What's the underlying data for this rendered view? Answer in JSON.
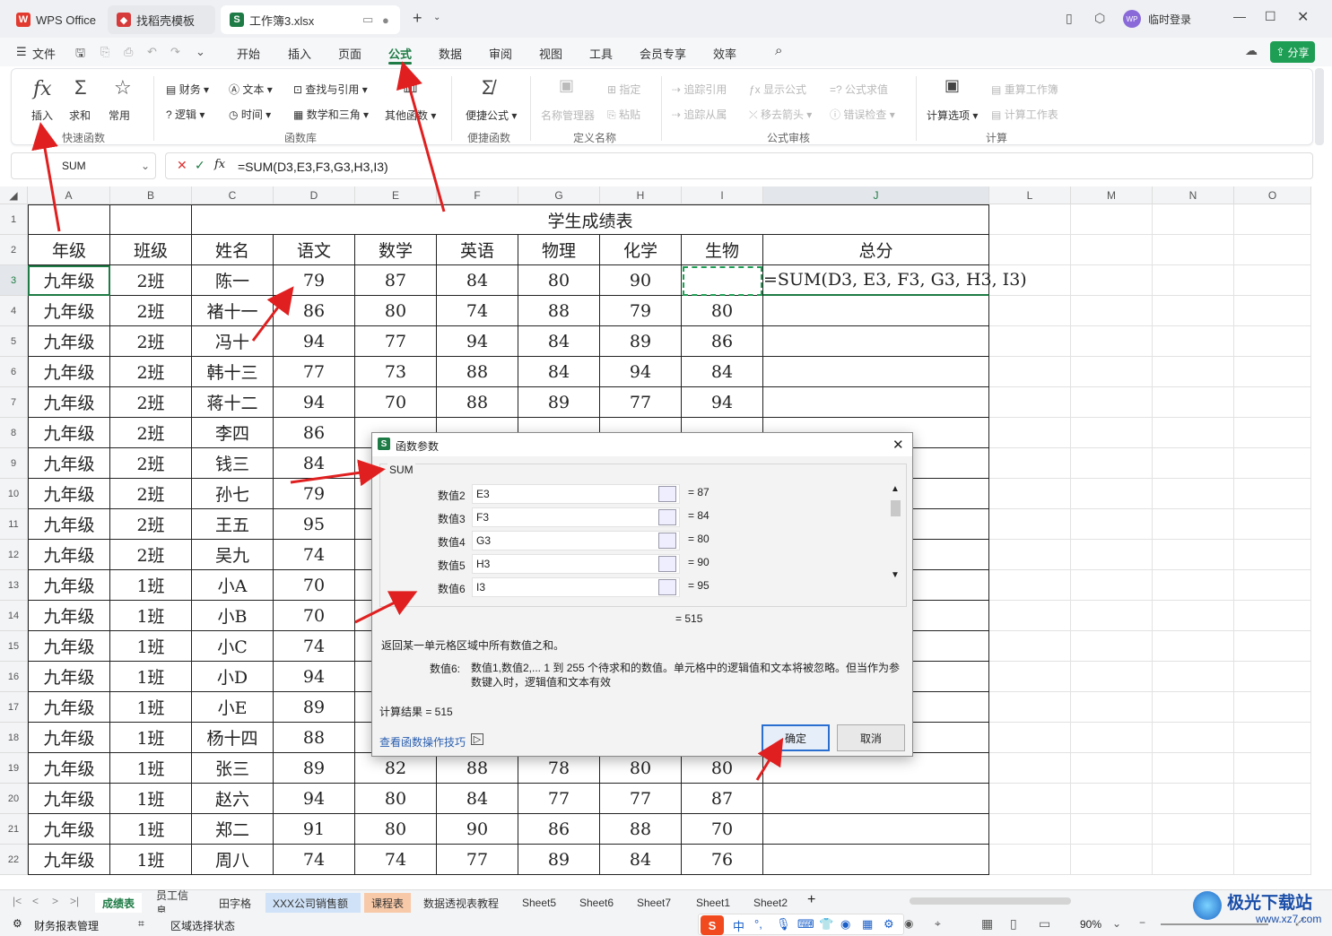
{
  "titlebar": {
    "tabs": [
      {
        "label": "WPS Office",
        "icon": "wps-logo-icon"
      },
      {
        "label": "找稻壳模板",
        "icon": "docer-logo-icon"
      },
      {
        "label": "工作簿3.xlsx",
        "icon": "spreadsheet-icon"
      }
    ],
    "login": "临时登录",
    "avatar": "WP"
  },
  "menu": {
    "file": "文件",
    "items": [
      "开始",
      "插入",
      "页面",
      "公式",
      "数据",
      "审阅",
      "视图",
      "工具",
      "会员专享",
      "效率"
    ],
    "active": "公式",
    "share": "分享"
  },
  "ribbon": {
    "quick": {
      "insert": "插入",
      "sum": "求和",
      "common": "常用",
      "group": "快速函数"
    },
    "library": {
      "finance": "财务",
      "text": "文本",
      "lookup": "查找与引用",
      "logic": "逻辑",
      "time": "时间",
      "math": "数学和三角",
      "other": "其他函数",
      "group": "函数库"
    },
    "convenient": {
      "formula": "便捷公式",
      "group": "便捷函数"
    },
    "names": {
      "manager": "名称管理器",
      "assign": "指定",
      "paste": "粘贴",
      "group": "定义名称"
    },
    "audit": {
      "trace_prec": "追踪引用",
      "show": "显示公式",
      "eval": "公式求值",
      "trace_dep": "追踪从属",
      "remove": "移去箭头",
      "error": "错误检查",
      "group": "公式审核"
    },
    "calc": {
      "options": "计算选项",
      "recalc_book": "重算工作簿",
      "calc_sheet": "计算工作表",
      "group": "计算"
    }
  },
  "formula_bar": {
    "name_box": "SUM",
    "formula": "=SUM(D3,E3,F3,G3,H3,I3)"
  },
  "grid": {
    "col_headers": [
      "A",
      "B",
      "C",
      "D",
      "E",
      "F",
      "G",
      "H",
      "I",
      "J",
      "L",
      "M",
      "N",
      "O"
    ],
    "title": "学生成绩表",
    "headers": [
      "年级",
      "班级",
      "姓名",
      "语文",
      "数学",
      "英语",
      "物理",
      "化学",
      "生物",
      "总分"
    ],
    "rows": [
      [
        "九年级",
        "2班",
        "陈一",
        "79",
        "87",
        "84",
        "80",
        "90",
        "",
        "=SUM(D3, E3, F3, G3, H3, I3)"
      ],
      [
        "九年级",
        "2班",
        "褚十一",
        "86",
        "80",
        "74",
        "88",
        "79",
        "80",
        ""
      ],
      [
        "九年级",
        "2班",
        "冯十",
        "94",
        "77",
        "94",
        "84",
        "89",
        "86",
        ""
      ],
      [
        "九年级",
        "2班",
        "韩十三",
        "77",
        "73",
        "88",
        "84",
        "94",
        "84",
        ""
      ],
      [
        "九年级",
        "2班",
        "蒋十二",
        "94",
        "70",
        "88",
        "89",
        "77",
        "94",
        ""
      ],
      [
        "九年级",
        "2班",
        "李四",
        "86",
        "",
        "",
        "",
        "",
        "",
        ""
      ],
      [
        "九年级",
        "2班",
        "钱三",
        "84",
        "",
        "",
        "",
        "",
        "",
        ""
      ],
      [
        "九年级",
        "2班",
        "孙七",
        "79",
        "",
        "",
        "",
        "",
        "",
        ""
      ],
      [
        "九年级",
        "2班",
        "王五",
        "95",
        "",
        "",
        "",
        "",
        "",
        ""
      ],
      [
        "九年级",
        "2班",
        "吴九",
        "74",
        "",
        "",
        "",
        "",
        "",
        ""
      ],
      [
        "九年级",
        "1班",
        "小A",
        "70",
        "",
        "",
        "",
        "",
        "",
        ""
      ],
      [
        "九年级",
        "1班",
        "小B",
        "70",
        "",
        "",
        "",
        "",
        "",
        ""
      ],
      [
        "九年级",
        "1班",
        "小C",
        "74",
        "",
        "",
        "",
        "",
        "",
        ""
      ],
      [
        "九年级",
        "1班",
        "小D",
        "94",
        "",
        "",
        "",
        "",
        "",
        ""
      ],
      [
        "九年级",
        "1班",
        "小E",
        "89",
        "",
        "",
        "",
        "",
        "",
        ""
      ],
      [
        "九年级",
        "1班",
        "杨十四",
        "88",
        "",
        "",
        "",
        "",
        "",
        ""
      ],
      [
        "九年级",
        "1班",
        "张三",
        "89",
        "82",
        "88",
        "78",
        "80",
        "80",
        ""
      ],
      [
        "九年级",
        "1班",
        "赵六",
        "94",
        "80",
        "84",
        "77",
        "77",
        "87",
        ""
      ],
      [
        "九年级",
        "1班",
        "郑二",
        "91",
        "80",
        "90",
        "86",
        "88",
        "70",
        ""
      ],
      [
        "九年级",
        "1班",
        "周八",
        "74",
        "74",
        "77",
        "89",
        "84",
        "76",
        ""
      ]
    ]
  },
  "dialog": {
    "title": "函数参数",
    "function": "SUM",
    "args": [
      {
        "label": "数值2",
        "value": "E3",
        "result": "= 87"
      },
      {
        "label": "数值3",
        "value": "F3",
        "result": "= 84"
      },
      {
        "label": "数值4",
        "value": "G3",
        "result": "= 80"
      },
      {
        "label": "数值5",
        "value": "H3",
        "result": "= 90"
      },
      {
        "label": "数值6",
        "value": "I3",
        "result": "= 95"
      }
    ],
    "total": "= 515",
    "description": "返回某一单元格区域中所有数值之和。",
    "arg_name": "数值6:",
    "arg_desc": "数值1,数值2,... 1 到 255 个待求和的数值。单元格中的逻辑值和文本将被忽略。但当作为参数键入时，逻辑值和文本有效",
    "calc_result": "计算结果 = 515",
    "help_link": "查看函数操作技巧",
    "ok": "确定",
    "cancel": "取消"
  },
  "sheets": [
    "成绩表",
    "员工信息",
    "田字格",
    "XXX公司销售额",
    "课程表",
    "数据透视表教程",
    "Sheet5",
    "Sheet6",
    "Sheet7",
    "Sheet1",
    "Sheet2"
  ],
  "active_sheet": "成绩表",
  "status": {
    "left1": "财务报表管理",
    "left2": "区域选择状态",
    "zoom": "90%"
  },
  "watermark": {
    "brand": "极光下载站",
    "url": "www.xz7.com"
  },
  "colors": {
    "accent": "#1e7b45",
    "arrow": "#e02020",
    "link": "#2a5fb0"
  }
}
